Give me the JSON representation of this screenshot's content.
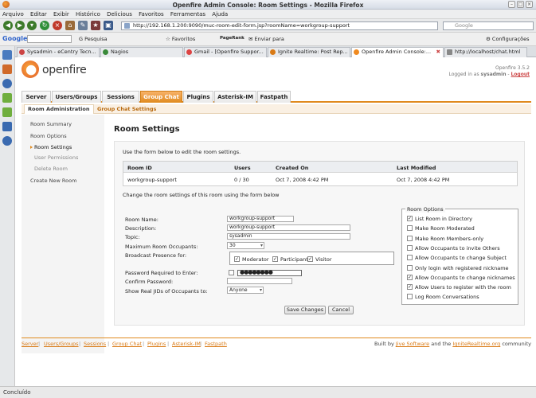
{
  "window": {
    "title": "Openfire Admin Console: Room Settings - Mozilla Firefox"
  },
  "menu": [
    "Arquivo",
    "Editar",
    "Exibir",
    "Histórico",
    "Delicious",
    "Favoritos",
    "Ferramentas",
    "Ajuda"
  ],
  "navbar": {
    "url": "http://192.168.1.200:9090/muc-room-edit-form.jsp?roomName=workgroup-support",
    "search_placeholder": "Google"
  },
  "google_toolbar": {
    "logo": "Google",
    "search_label": "Pesquisa",
    "favoritos": "Favoritos",
    "pagerank": "PageRank",
    "enviar": "Enviar para",
    "config": "Configurações"
  },
  "tabs": [
    {
      "label": "Sysadmin - eCentry Tecn..."
    },
    {
      "label": "Nagios"
    },
    {
      "label": "Gmail - [Openfire Suppor..."
    },
    {
      "label": "Ignite Realtime: Post Rep..."
    },
    {
      "label": "Openfire Admin Console:..."
    },
    {
      "label": "http://localhost/chat.html"
    }
  ],
  "header": {
    "logo_text": "openfire",
    "version": "Openfire 3.5.2",
    "logged_in": "Logged in as",
    "user": "sysadmin",
    "logout": "Logout"
  },
  "main_nav": [
    "Server",
    "Users/Groups",
    "Sessions",
    "Group Chat",
    "Plugins",
    "Asterisk-IM",
    "Fastpath"
  ],
  "sub_nav": [
    "Room Administration",
    "Group Chat Settings"
  ],
  "left_nav": {
    "room_summary": "Room Summary",
    "room_options": "Room Options",
    "room_settings": "Room Settings",
    "user_permissions": "User Permissions",
    "delete_room": "Delete Room",
    "create_room": "Create New Room"
  },
  "page": {
    "title": "Room Settings",
    "intro": "Use the form below to edit the room settings.",
    "change_text": "Change the room settings of this room using the form below"
  },
  "room_table": {
    "headers": [
      "Room ID",
      "Users",
      "Created On",
      "Last Modified"
    ],
    "row": [
      "workgroup-support",
      "0 / 30",
      "Oct 7, 2008 4:42 PM",
      "Oct 7, 2008 4:42 PM"
    ]
  },
  "form": {
    "room_name_label": "Room Name:",
    "room_name": "workgroup-support",
    "description_label": "Description:",
    "description": "workgroup-support",
    "topic_label": "Topic:",
    "topic": "sysadmin",
    "max_label": "Maximum Room Occupants:",
    "max_value": "30",
    "broadcast_label": "Broadcast Presence for:",
    "broadcast": [
      "Moderator",
      "Participant",
      "Visitor"
    ],
    "password_required_label": "Password Required to Enter:",
    "password_mask": "●●●●●●●●",
    "confirm_label": "Confirm Password:",
    "jid_label": "Show Real JIDs of Occupants to:",
    "jid_value": "Anyone"
  },
  "room_options": {
    "legend": "Room Options",
    "items": [
      {
        "label": "List Room in Directory",
        "checked": true
      },
      {
        "label": "Make Room Moderated",
        "checked": false
      },
      {
        "label": "Make Room Members-only",
        "checked": false
      },
      {
        "label": "Allow Occupants to invite Others",
        "checked": false
      },
      {
        "label": "Allow Occupants to change Subject",
        "checked": false
      },
      {
        "label": "Only login with registered nickname",
        "checked": false
      },
      {
        "label": "Allow Occupants to change nicknames",
        "checked": true
      },
      {
        "label": "Allow Users to register with the room",
        "checked": true
      },
      {
        "label": "Log Room Conversations",
        "checked": false
      }
    ]
  },
  "buttons": {
    "save": "Save Changes",
    "cancel": "Cancel"
  },
  "footer": {
    "links": [
      "Server",
      "Users/Groups",
      "Sessions",
      "Group Chat",
      "Plugins",
      "Asterisk-IM",
      "Fastpath"
    ],
    "built_by": "Built by",
    "jive": "Jive Software",
    "and_the": "and the",
    "ignite": "IgniteRealtime.org",
    "community": "community"
  },
  "status": {
    "text": "Concluído"
  }
}
